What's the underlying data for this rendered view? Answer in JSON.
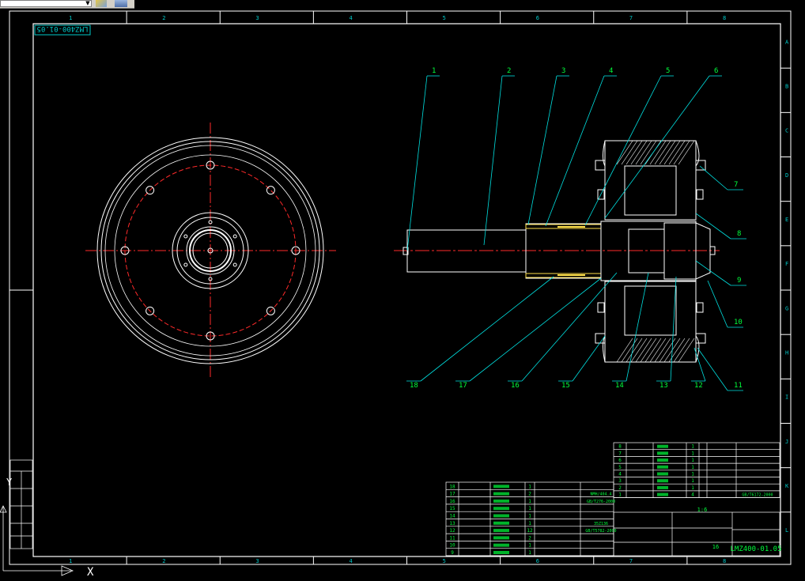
{
  "drawing_number": "LMZ400-01.05",
  "drawing_number_mirrored": "LMZ400-01.05",
  "colors": {
    "background": "#000000",
    "border": "#ffffff",
    "frame": "#00c8c8",
    "centerline": "#ff2a2a",
    "leader": "#00e0e0",
    "text_green": "#00ff3c",
    "highlight": "#ffe14a"
  },
  "column_labels": [
    "1",
    "2",
    "3",
    "4",
    "5",
    "6",
    "7",
    "8"
  ],
  "row_labels": [
    "A",
    "B",
    "C",
    "D",
    "E",
    "F",
    "G",
    "H",
    "I",
    "J",
    "K",
    "L"
  ],
  "balloons": {
    "top": [
      "1",
      "2",
      "3",
      "4",
      "5",
      "6"
    ],
    "right": [
      "7",
      "8",
      "9",
      "10",
      "11"
    ],
    "bottom": [
      "18",
      "17",
      "16",
      "15",
      "14",
      "13",
      "12"
    ]
  },
  "parts_upper": {
    "rows": [
      {
        "no": "8",
        "qty": "1"
      },
      {
        "no": "7",
        "qty": "1"
      },
      {
        "no": "6",
        "qty": "1"
      },
      {
        "no": "5",
        "qty": "1"
      },
      {
        "no": "4",
        "qty": "1"
      },
      {
        "no": "3",
        "qty": "1"
      },
      {
        "no": "2",
        "qty": "1"
      },
      {
        "no": "1",
        "qty": "4",
        "std": "GB/T6172-2000"
      }
    ]
  },
  "parts_lower": {
    "rows": [
      {
        "no": "18",
        "qty": "1"
      },
      {
        "no": "17",
        "qty": "2",
        "std": "NMH/404.4"
      },
      {
        "no": "16",
        "qty": "1",
        "std": "GB/T276-2000"
      },
      {
        "no": "15",
        "qty": "1"
      },
      {
        "no": "14",
        "qty": "1"
      },
      {
        "no": "13",
        "qty": "1",
        "std": "35Z136"
      },
      {
        "no": "12",
        "qty": "12",
        "std": "GB/T5782-2000"
      },
      {
        "no": "11",
        "qty": "2"
      },
      {
        "no": "10",
        "qty": "1"
      },
      {
        "no": "9",
        "qty": "1"
      }
    ]
  },
  "title_block": {
    "drawing_no": "LMZ400-01.05",
    "qty": "1",
    "sheet": "16",
    "weight": "1:6"
  },
  "ucs": {
    "x_label": "X",
    "y_label": "Y"
  }
}
